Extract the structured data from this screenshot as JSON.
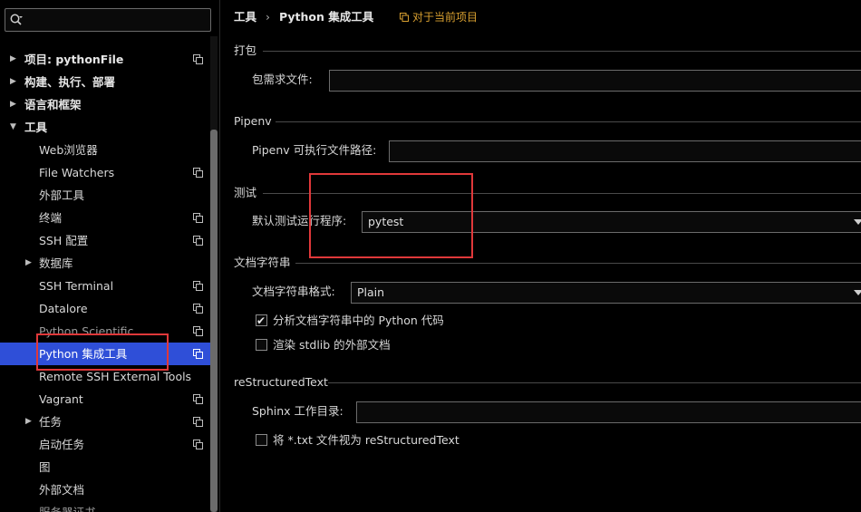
{
  "search": {
    "value": "",
    "placeholder": ""
  },
  "sidebar": {
    "items": [
      {
        "label": "项目: pythonFile",
        "arrow": "▶",
        "copy": true
      },
      {
        "label": "构建、执行、部署",
        "arrow": "▶",
        "copy": false
      },
      {
        "label": "语言和框架",
        "arrow": "▶",
        "copy": false
      },
      {
        "label": "工具",
        "arrow": "▼",
        "copy": false
      },
      {
        "label": "Web浏览器",
        "arrow": "",
        "copy": false
      },
      {
        "label": "File Watchers",
        "arrow": "",
        "copy": true
      },
      {
        "label": "外部工具",
        "arrow": "",
        "copy": false
      },
      {
        "label": "终端",
        "arrow": "",
        "copy": true
      },
      {
        "label": "SSH 配置",
        "arrow": "",
        "copy": true
      },
      {
        "label": "数据库",
        "arrow": "▶",
        "copy": false
      },
      {
        "label": "SSH Terminal",
        "arrow": "",
        "copy": true
      },
      {
        "label": "Datalore",
        "arrow": "",
        "copy": true
      },
      {
        "label": "Python Scientific",
        "arrow": "",
        "copy": true
      },
      {
        "label": "Python 集成工具",
        "arrow": "",
        "copy": true
      },
      {
        "label": "Remote SSH External Tools",
        "arrow": "",
        "copy": false
      },
      {
        "label": "Vagrant",
        "arrow": "",
        "copy": true
      },
      {
        "label": "任务",
        "arrow": "▶",
        "copy": true
      },
      {
        "label": "启动任务",
        "arrow": "",
        "copy": true
      },
      {
        "label": "图",
        "arrow": "",
        "copy": false
      },
      {
        "label": "外部文档",
        "arrow": "",
        "copy": false
      },
      {
        "label": "服务器证书",
        "arrow": "",
        "copy": false
      }
    ]
  },
  "header": {
    "crumb_root": "工具",
    "crumb_sep": "›",
    "crumb_current": "Python 集成工具",
    "project_link": "对于当前项目"
  },
  "packaging": {
    "title": "打包",
    "requirements_label": "包需求文件:",
    "requirements_value": ""
  },
  "pipenv": {
    "title": "Pipenv",
    "path_label": "Pipenv 可执行文件路径:",
    "path_value": ""
  },
  "testing": {
    "title": "测试",
    "runner_label": "默认测试运行程序:",
    "runner_value": "pytest"
  },
  "docstrings": {
    "title": "文档字符串",
    "format_label": "文档字符串格式:",
    "format_value": "Plain",
    "analyze_label": "分析文档字符串中的 Python 代码",
    "analyze_checked": true,
    "render_label": "渲染 stdlib 的外部文档",
    "render_checked": false
  },
  "rest": {
    "title": "reStructuredText",
    "sphinx_label": "Sphinx 工作目录:",
    "sphinx_value": "",
    "txt_label": "将 *.txt 文件视为 reStructuredText",
    "txt_checked": false
  },
  "colors": {
    "selection": "#2f4fd8",
    "link": "#d9a030",
    "annotation": "#e0383a"
  }
}
